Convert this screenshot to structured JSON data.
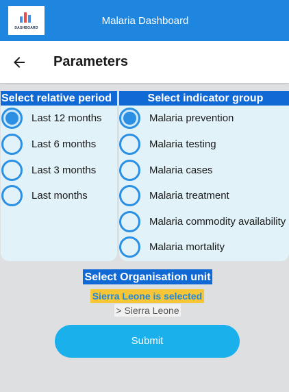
{
  "app": {
    "title": "Malaria Dashboard",
    "logo_text": "DASHBOARD",
    "logo_bar_colors": [
      "#4a90e2",
      "#e94f4f",
      "#4a90e2"
    ]
  },
  "toolbar": {
    "title": "Parameters"
  },
  "period": {
    "heading": "Select relative period",
    "options": [
      {
        "label": "Last 12 months",
        "selected": true
      },
      {
        "label": "Last 6 months",
        "selected": false
      },
      {
        "label": "Last 3 months",
        "selected": false
      },
      {
        "label": "Last months",
        "selected": false
      }
    ]
  },
  "indicator": {
    "heading": "Select indicator group",
    "options": [
      {
        "label": "Malaria prevention",
        "selected": true
      },
      {
        "label": "Malaria testing",
        "selected": false
      },
      {
        "label": "Malaria cases",
        "selected": false
      },
      {
        "label": "Malaria treatment",
        "selected": false
      },
      {
        "label": "Malaria commodity availability",
        "selected": false
      },
      {
        "label": "Malaria mortality",
        "selected": false
      }
    ]
  },
  "org_unit": {
    "heading": "Select Organisation unit",
    "selected_text": "Sierra Leone is selected",
    "path": "> Sierra Leone"
  },
  "submit_label": "Submit",
  "colors": {
    "appbar": "#1f86e0",
    "heading_bg": "#1169d6",
    "panel_bg": "#e1f2f9",
    "radio": "#2b8fe4",
    "highlight": "#f6c637",
    "submit": "#1ab0ec"
  }
}
